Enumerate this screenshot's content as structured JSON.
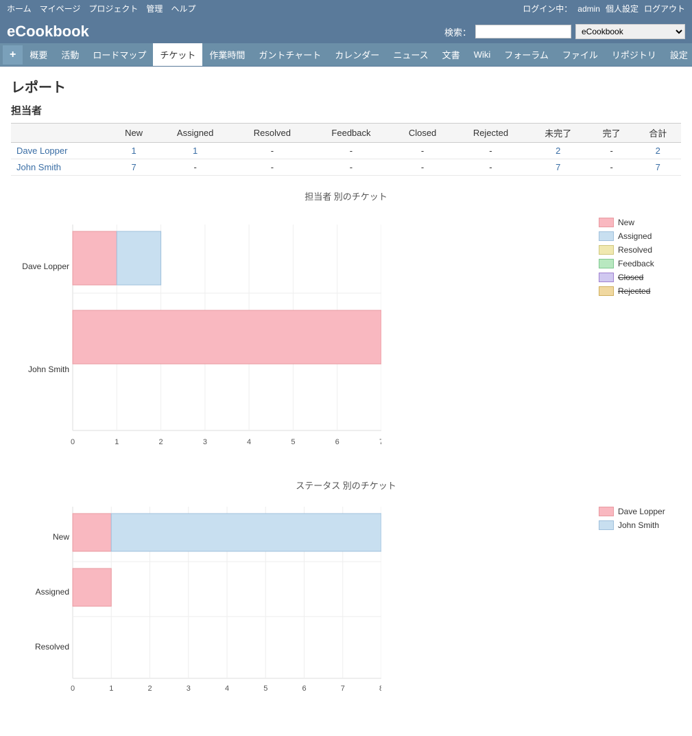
{
  "topbar": {
    "links": [
      "ホーム",
      "マイページ",
      "プロジェクト",
      "管理",
      "ヘルプ"
    ],
    "user_label": "ログイン中：",
    "username": "admin",
    "personal_settings": "個人設定",
    "logout": "ログアウト"
  },
  "header": {
    "logo": "eCookbook",
    "search_label": "検索：",
    "search_placeholder": "",
    "project_select": "eCookbook"
  },
  "nav": {
    "add_button": "+",
    "items": [
      {
        "label": "概要",
        "active": false
      },
      {
        "label": "活動",
        "active": false
      },
      {
        "label": "ロードマップ",
        "active": false
      },
      {
        "label": "チケット",
        "active": true
      },
      {
        "label": "作業時間",
        "active": false
      },
      {
        "label": "ガントチャート",
        "active": false
      },
      {
        "label": "カレンダー",
        "active": false
      },
      {
        "label": "ニュース",
        "active": false
      },
      {
        "label": "文書",
        "active": false
      },
      {
        "label": "Wiki",
        "active": false
      },
      {
        "label": "フォーラム",
        "active": false
      },
      {
        "label": "ファイル",
        "active": false
      },
      {
        "label": "リポジトリ",
        "active": false
      },
      {
        "label": "設定",
        "active": false
      }
    ]
  },
  "page": {
    "title": "レポート",
    "assignee_section_title": "担当者",
    "chart1_title": "担当者 別のチケット",
    "chart2_title": "ステータス 別のチケット"
  },
  "table": {
    "headers": [
      "",
      "New",
      "Assigned",
      "Resolved",
      "Feedback",
      "Closed",
      "Rejected",
      "未完了",
      "完了",
      "合計"
    ],
    "rows": [
      {
        "name": "Dave Lopper",
        "new": "1",
        "assigned": "1",
        "resolved": "-",
        "feedback": "-",
        "closed": "-",
        "rejected": "-",
        "incomplete": "2",
        "complete": "-",
        "total": "2"
      },
      {
        "name": "John Smith",
        "new": "7",
        "assigned": "-",
        "resolved": "-",
        "feedback": "-",
        "closed": "-",
        "rejected": "-",
        "incomplete": "7",
        "complete": "-",
        "total": "7"
      }
    ]
  },
  "chart1": {
    "title": "担当者 別のチケット",
    "assignees": [
      "Dave Lopper",
      "John Smith"
    ],
    "legend": [
      {
        "label": "New",
        "color": "#f9b8c0",
        "border": "#e89aa0"
      },
      {
        "label": "Assigned",
        "color": "#c8dff0",
        "border": "#a0c0dc"
      },
      {
        "label": "Resolved",
        "color": "#f0e8b0",
        "border": "#d0c880"
      },
      {
        "label": "Feedback",
        "color": "#b8e8c0",
        "border": "#80c890"
      },
      {
        "label": "Closed",
        "color": "#d0c8f0",
        "border": "#a080d0"
      },
      {
        "label": "Rejected",
        "color": "#f0d8a0",
        "border": "#d0b060"
      }
    ],
    "max": 7,
    "bars": [
      {
        "assignee": "Dave Lopper",
        "segments": [
          {
            "status": "New",
            "value": 1
          },
          {
            "status": "Assigned",
            "value": 1
          }
        ]
      },
      {
        "assignee": "John Smith",
        "segments": [
          {
            "status": "New",
            "value": 7
          }
        ]
      }
    ]
  },
  "chart2": {
    "title": "ステータス 別のチケット",
    "statuses": [
      "New",
      "Assigned",
      "Resolved"
    ],
    "legend": [
      {
        "label": "Dave Lopper",
        "color": "#f9b8c0",
        "border": "#e89aa0"
      },
      {
        "label": "John Smith",
        "color": "#c8dff0",
        "border": "#a0c0dc"
      }
    ],
    "max": 7,
    "bars": [
      {
        "status": "New",
        "segments": [
          {
            "who": "Dave Lopper",
            "value": 1
          },
          {
            "who": "John Smith",
            "value": 7
          }
        ]
      },
      {
        "status": "Assigned",
        "segments": [
          {
            "who": "Dave Lopper",
            "value": 1
          }
        ]
      },
      {
        "status": "Resolved",
        "segments": []
      }
    ]
  }
}
